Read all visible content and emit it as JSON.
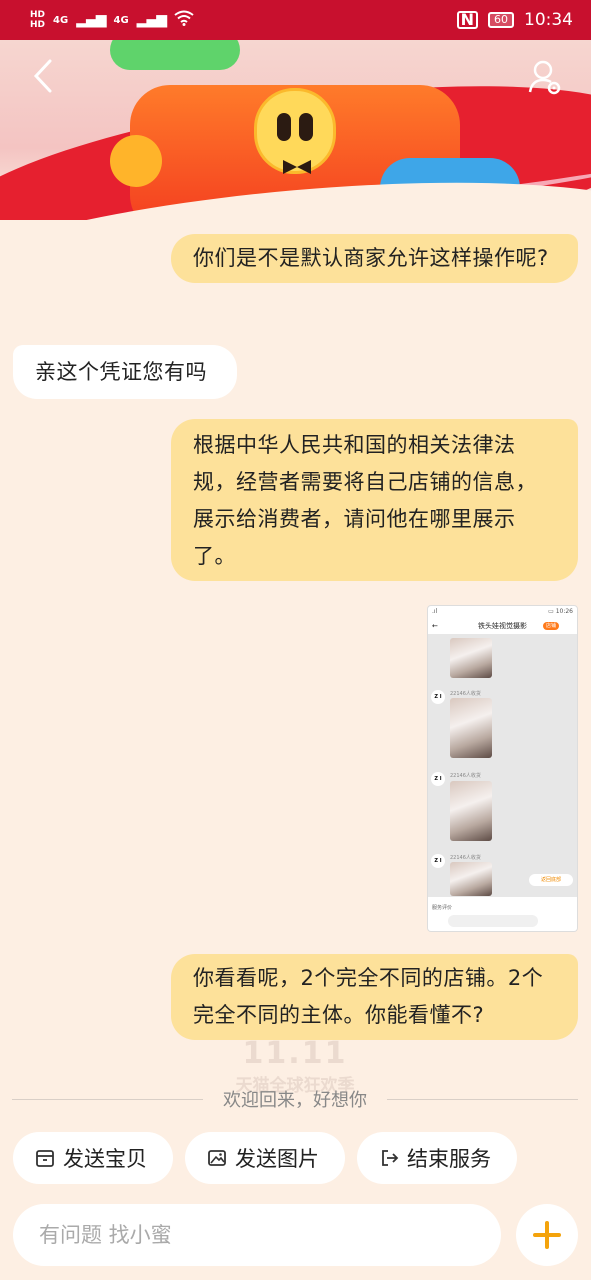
{
  "status_bar": {
    "hd1": "HD",
    "hd2": "HD",
    "net1": "4G",
    "net2": "4G",
    "battery": "60",
    "time": "10:34"
  },
  "header": {
    "back_icon": "chevron-left-icon",
    "profile_icon": "user-settings-icon"
  },
  "messages": [
    {
      "from": "me",
      "text": "你们是不是默认商家允许这样操作呢?"
    },
    {
      "from": "them",
      "text": "亲这个凭证您有吗"
    },
    {
      "from": "me",
      "text": "根据中华人民共和国的相关法律法规，经营者需要将自己店铺的信息，展示给消费者，请问他在哪里展示了。"
    },
    {
      "from": "me",
      "type": "image",
      "inner": {
        "title": "铁头娃视觉摄影",
        "badge": "店铺",
        "tags": [
          "22146人收货",
          "22146人收货",
          "22146人收货"
        ],
        "avatar": "Z I",
        "row": "服务评价",
        "pill": "返回底部"
      }
    },
    {
      "from": "me",
      "text": "你看看呢，2个完全不同的店铺。2个完全不同的主体。你能看懂不?"
    }
  ],
  "watermark": "天猫全球狂欢季",
  "divider_text": "欢迎回来，好想你",
  "quick_actions": [
    {
      "label": "发送宝贝",
      "icon": "box-icon"
    },
    {
      "label": "发送图片",
      "icon": "image-icon"
    },
    {
      "label": "结束服务",
      "icon": "exit-icon"
    }
  ],
  "input": {
    "placeholder": "有问题 找小蜜"
  },
  "colors": {
    "status_bar": "#c8102e",
    "background": "#fdefe3",
    "my_bubble": "#fde19a",
    "their_bubble": "#ffffff",
    "accent": "#f4a30c"
  }
}
